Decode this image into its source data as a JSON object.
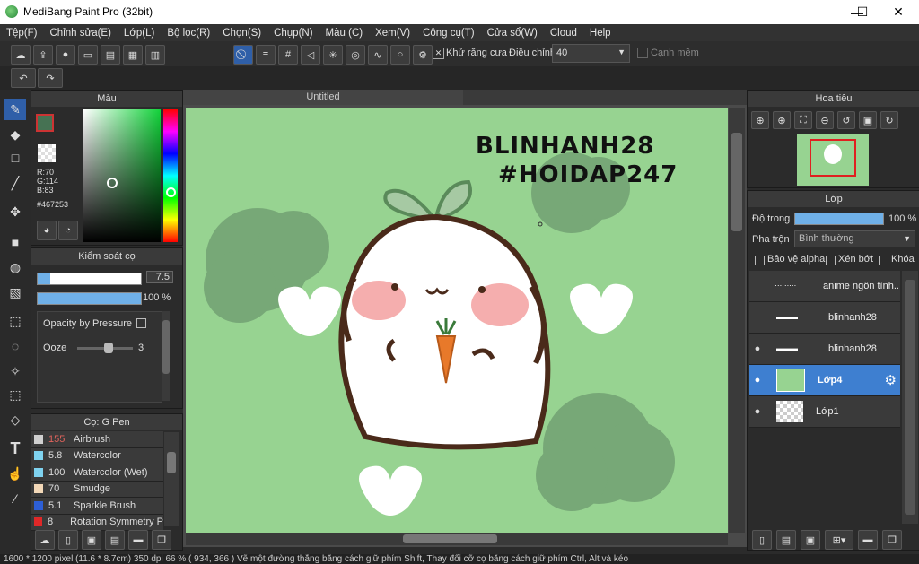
{
  "window": {
    "title": "MediBang Paint Pro (32bit)",
    "minimize": "—",
    "maximize": "☐",
    "close": "✕"
  },
  "menu": [
    "Tệp(F)",
    "Chỉnh sửa(E)",
    "Lớp(L)",
    "Bộ lọc(R)",
    "Chọn(S)",
    "Chụp(N)",
    "Màu (C)",
    "Xem(V)",
    "Công cụ(T)",
    "Cửa sổ(W)",
    "Cloud",
    "Help"
  ],
  "toolbar": {
    "antialias_label": "Khử răng cưa",
    "adjust_label": "Điều chỉnh",
    "adjust_value": "40",
    "edge_label": "Cạnh mềm"
  },
  "color_panel": {
    "title": "Màu",
    "r": "R:70",
    "g": "G:114",
    "b": "B:83",
    "hex": "#467253",
    "main_color": "#467253"
  },
  "brush_control": {
    "title": "Kiểm soát cọ",
    "size": "7.5",
    "opacity": "100 %",
    "opacity_by_pressure": "Opacity by Pressure",
    "ooze_label": "Ooze",
    "ooze_value": "3"
  },
  "brush_panel": {
    "title": "Cọ: G Pen",
    "items": [
      {
        "size": "155",
        "name": "Airbrush",
        "color": "#cfcfcf"
      },
      {
        "size": "5.8",
        "name": "Watercolor",
        "color": "#7fd3f0"
      },
      {
        "size": "100",
        "name": "Watercolor (Wet)",
        "color": "#7fd3f0"
      },
      {
        "size": "70",
        "name": "Smudge",
        "color": "#f3d8b8"
      },
      {
        "size": "5.1",
        "name": "Sparkle Brush",
        "color": "#2d5fd6"
      },
      {
        "size": "8",
        "name": "Rotation Symmetry P",
        "color": "#e02828"
      }
    ]
  },
  "canvas": {
    "tab_title": "Untitled",
    "text_line1": "BLINHANH28",
    "text_line2": "#HOIDAP247"
  },
  "navigator": {
    "title": "Hoa tiêu"
  },
  "layer_panel": {
    "title": "Lớp",
    "opacity_label": "Độ trong",
    "opacity_value": "100 %",
    "blend_label": "Pha trộn",
    "blend_value": "Bình thường",
    "protect_alpha": "Bảo vệ alpha",
    "clipping": "Xén bớt",
    "lock": "Khóa",
    "layers": [
      {
        "name": "anime ngôn tình...",
        "visible": false,
        "selected": false
      },
      {
        "name": "blinhanh28",
        "visible": false,
        "selected": false
      },
      {
        "name": "blinhanh28",
        "visible": true,
        "selected": false
      },
      {
        "name": "Lớp4",
        "visible": true,
        "selected": true
      },
      {
        "name": "Lớp1",
        "visible": true,
        "selected": false
      }
    ]
  },
  "status": "1600 * 1200 pixel   (11.6 * 8.7cm)   350 dpi   66 %   ( 934, 366 )   Vẽ một đường thẳng bằng cách giữ phím Shift, Thay đổi cỡ cọ bằng cách giữ phím Ctrl, Alt và kéo"
}
